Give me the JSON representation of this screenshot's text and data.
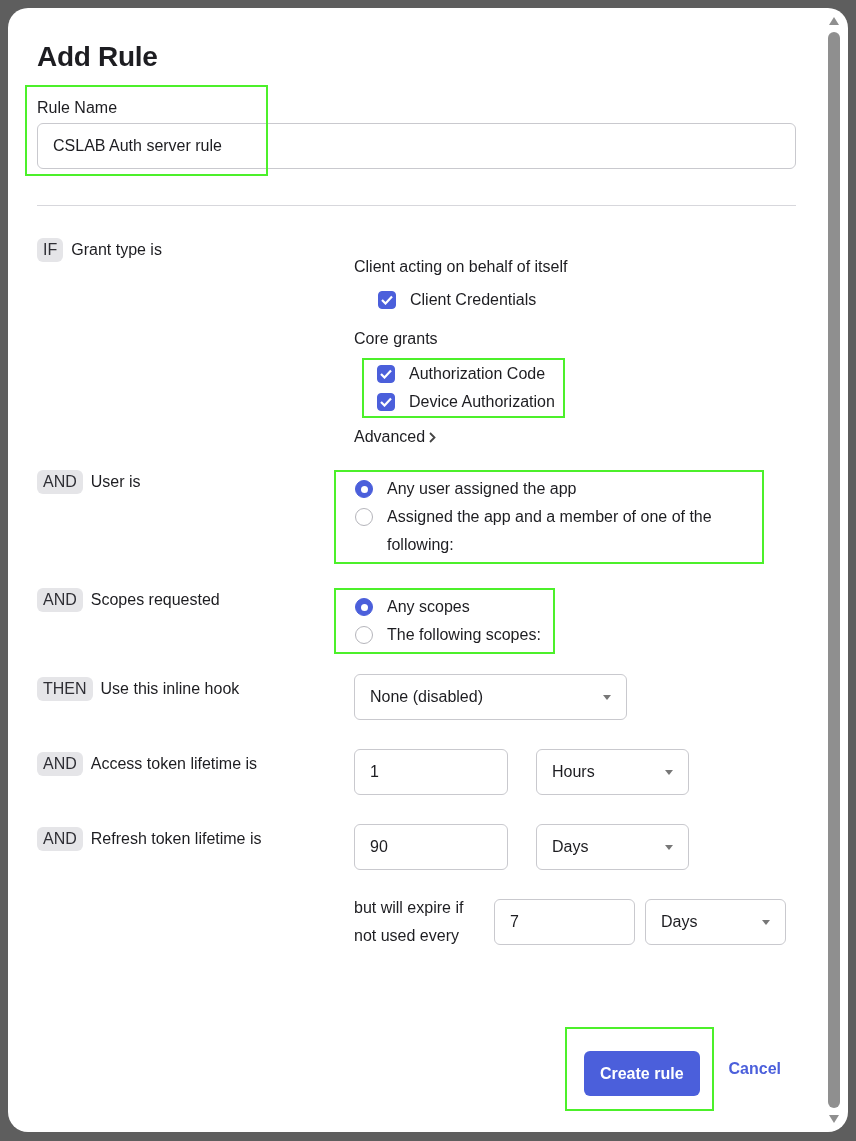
{
  "dialog": {
    "title": "Add Rule"
  },
  "rule_name": {
    "label": "Rule Name",
    "value": "CSLAB Auth server rule",
    "highlighted": true
  },
  "conditions": [
    {
      "kind": "grants",
      "keyword": "IF",
      "label": "Grant type is",
      "groups": [
        {
          "heading": "Client acting on behalf of itself",
          "highlighted": false,
          "options": [
            {
              "label": "Client Credentials",
              "checked": true
            }
          ]
        },
        {
          "heading": "Core grants",
          "highlighted": true,
          "options": [
            {
              "label": "Authorization Code",
              "checked": true
            },
            {
              "label": "Device Authorization",
              "checked": true
            }
          ]
        }
      ],
      "advanced_link": "Advanced"
    },
    {
      "kind": "radios",
      "keyword": "AND",
      "label": "User is",
      "highlighted": true,
      "options": [
        {
          "label": "Any user assigned the app",
          "selected": true
        },
        {
          "label": "Assigned the app and a member of one of the following:",
          "selected": false
        }
      ]
    },
    {
      "kind": "radios",
      "keyword": "AND",
      "label": "Scopes requested",
      "highlighted": true,
      "options": [
        {
          "label": "Any scopes",
          "selected": true
        },
        {
          "label": "The following scopes:",
          "selected": false
        }
      ]
    },
    {
      "kind": "select",
      "keyword": "THEN",
      "label": "Use this inline hook",
      "select": "None (disabled)"
    },
    {
      "kind": "lifetime",
      "keyword": "AND",
      "label": "Access token lifetime is",
      "value": "1",
      "unit": "Hours"
    },
    {
      "kind": "lifetime",
      "keyword": "AND",
      "label": "Refresh token lifetime is",
      "value": "90",
      "unit": "Days"
    },
    {
      "kind": "expiry",
      "text": "but will expire if not used every",
      "value": "7",
      "unit": "Days"
    }
  ],
  "footer": {
    "primary": "Create rule",
    "primary_highlighted": true,
    "cancel": "Cancel"
  }
}
